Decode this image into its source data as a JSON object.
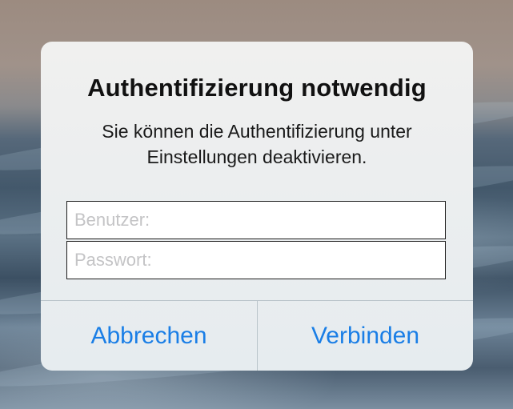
{
  "dialog": {
    "title": "Authentifizierung notwendig",
    "message_line1": "Sie können die Authentifizierung unter",
    "message_line2": "Einstellungen deaktivieren.",
    "username_placeholder": "Benutzer:",
    "password_placeholder": "Passwort:",
    "cancel_label": "Abbrechen",
    "connect_label": "Verbinden"
  },
  "colors": {
    "button_text": "#1a7ee6",
    "title_text": "#111111",
    "dialog_background": "#eceeef",
    "separator": "#b9c4ca"
  }
}
